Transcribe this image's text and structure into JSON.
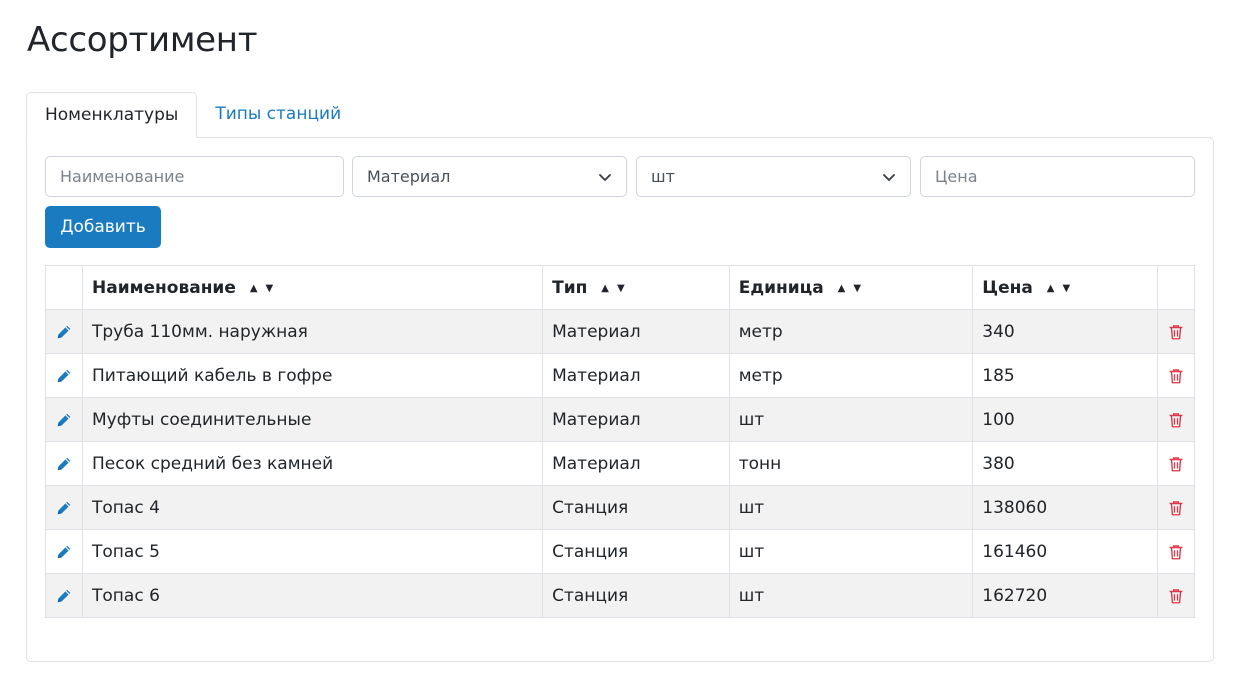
{
  "page": {
    "title": "Ассортимент"
  },
  "tabs": [
    {
      "label": "Номенклатуры",
      "active": true
    },
    {
      "label": "Типы станций",
      "active": false
    }
  ],
  "form": {
    "name_placeholder": "Наименование",
    "type_selected": "Материал",
    "unit_selected": "шт",
    "price_placeholder": "Цена",
    "add_label": "Добавить"
  },
  "table": {
    "columns": [
      "Наименование",
      "Тип",
      "Единица",
      "Цена"
    ],
    "sort_up": "▲",
    "sort_down": "▼",
    "rows": [
      {
        "name": "Труба 110мм. наружная",
        "type": "Материал",
        "unit": "метр",
        "price": "340"
      },
      {
        "name": "Питающий кабель в гофре",
        "type": "Материал",
        "unit": "метр",
        "price": "185"
      },
      {
        "name": "Муфты соединительные",
        "type": "Материал",
        "unit": "шт",
        "price": "100"
      },
      {
        "name": "Песок средний без камней",
        "type": "Материал",
        "unit": "тонн",
        "price": "380"
      },
      {
        "name": "Топас 4",
        "type": "Станция",
        "unit": "шт",
        "price": "138060"
      },
      {
        "name": "Топас 5",
        "type": "Станция",
        "unit": "шт",
        "price": "161460"
      },
      {
        "name": "Топас 6",
        "type": "Станция",
        "unit": "шт",
        "price": "162720"
      }
    ]
  },
  "colors": {
    "accent": "#1a7bc0",
    "edit_icon": "#1a7bc0",
    "delete_icon": "#dc3545"
  },
  "icons": {
    "edit": "pencil-icon",
    "delete": "trash-icon",
    "select": "chevron-down-icon"
  }
}
